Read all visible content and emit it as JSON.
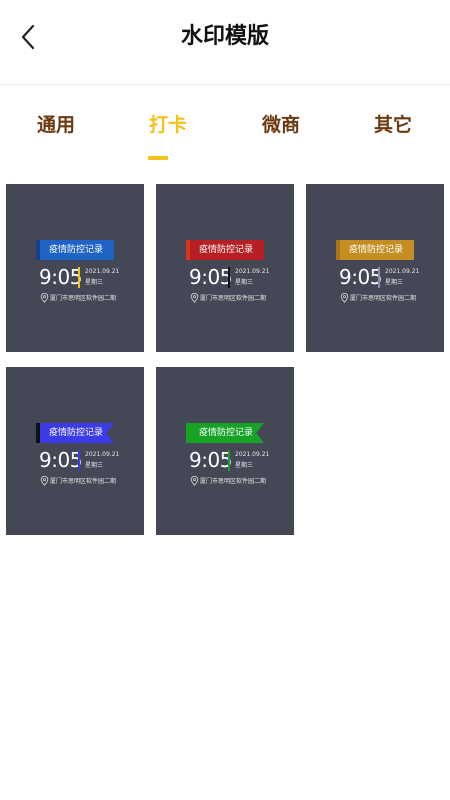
{
  "header": {
    "title": "水印模版",
    "back_icon": "chevron-left-icon"
  },
  "tabs": [
    {
      "label": "通用",
      "active": false
    },
    {
      "label": "打卡",
      "active": true
    },
    {
      "label": "微商",
      "active": false
    },
    {
      "label": "其它",
      "active": false
    }
  ],
  "colors": {
    "accent": "#f3c21b",
    "tab_text": "#6b3a10",
    "card_bg": "#434756"
  },
  "templates": [
    {
      "flag_text": "疫情防控记录",
      "time": "9:05",
      "date": "2021.09.21",
      "weekday": "星期三",
      "location": "厦门市思明区软件园二期",
      "flag_color": "#1f63c4",
      "flag_strip": "#1a3f8a",
      "divider_color": "#f3c21b",
      "flag_style": "plain"
    },
    {
      "flag_text": "疫情防控记录",
      "time": "9:05",
      "date": "2021.09.21",
      "weekday": "星期三",
      "location": "厦门市思明区软件园二期",
      "flag_color": "#b52025",
      "flag_strip": "#d8351e",
      "divider_color": "#111111",
      "flag_style": "plain"
    },
    {
      "flag_text": "疫情防控记录",
      "time": "9:05",
      "date": "2021.09.21",
      "weekday": "星期三",
      "location": "厦门市思明区软件园二期",
      "flag_color": "#c48e23",
      "flag_strip": "#a87418",
      "divider_color": "#8a8fa8",
      "flag_style": "plain"
    },
    {
      "flag_text": "疫情防控记录",
      "time": "9:05",
      "date": "2021.09.21",
      "weekday": "星期三",
      "location": "厦门市思明区软件园二期",
      "flag_color": "#3b3bea",
      "flag_strip": "#111111",
      "divider_color": "#3b3bea",
      "flag_style": "notch"
    },
    {
      "flag_text": "疫情防控记录",
      "time": "9:05",
      "date": "2021.09.21",
      "weekday": "星期三",
      "location": "厦门市思明区软件园二期",
      "flag_color": "#16a326",
      "flag_strip": "#16a326",
      "divider_color": "#16a326",
      "flag_style": "notch"
    }
  ]
}
